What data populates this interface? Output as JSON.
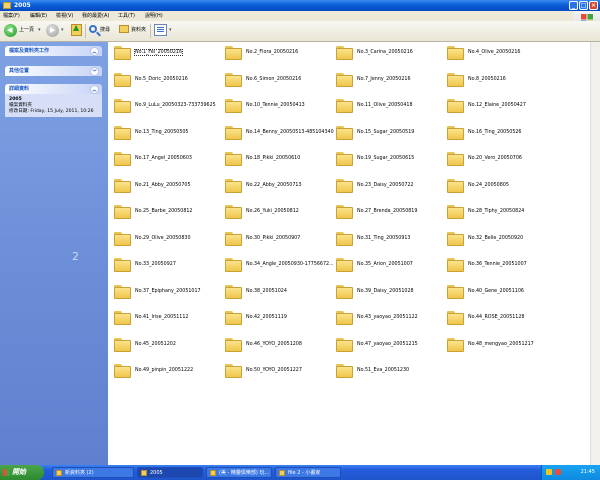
{
  "window": {
    "title": "2005"
  },
  "menu": [
    "檔案(F)",
    "編輯(E)",
    "檢視(V)",
    "我的最愛(A)",
    "工具(T)",
    "說明(H)"
  ],
  "toolbar": {
    "back": "上一頁",
    "search": "搜尋",
    "folders": "資料夾"
  },
  "sidebar": {
    "panels": [
      {
        "title": "檔案及資料夾工作"
      },
      {
        "title": "其他位置"
      },
      {
        "title": "詳細資料",
        "name": "2005",
        "type": "檔案資料夾",
        "modified": "修改日期: Friday, 15 July, 2011, 10:26"
      }
    ],
    "page_number": "2"
  },
  "folders": [
    "No.1_Fei_20050216",
    "No.2_Flora_20050216",
    "No.3_Carina_20050216",
    "No.4_Olive_20050216",
    "No.5_Doric_20050216",
    "No.6_Simon_20050216",
    "No.7_Jenny_20050216",
    "No.8_20050216",
    "No.9_LuLu_20050323-733739625",
    "No.10_Tennie_20050413",
    "No.11_Olive_20050418",
    "No.12_Elaine_20050427",
    "No.13_Ting_20050505",
    "No.14_Benny_20050513-485104340",
    "No.15_Sugar_20050519",
    "No.16_Ting_20050526",
    "No.17_Angel_20050603",
    "No.18_Pikki_20050610",
    "No.19_Sugar_20050615",
    "No.20_Vero_20050706",
    "No.21_Abby_20050705",
    "No.22_Abby_20050713",
    "No.23_Daisy_20050722",
    "No.24_20050805",
    "No.25_Barbe_20050812",
    "No.26_Yuki_20050812",
    "No.27_Brenda_20050819",
    "No.28_Tiphy_20050824",
    "No.29_Olive_20050830",
    "No.30_Pikki_20050907",
    "No.31_Ting_20050913",
    "No.32_Belle_20050920",
    "No.33_20050927",
    "No.34_Angle_20050930-17756672...",
    "No.35_Arion_20051007",
    "No.36_Tennie_20051007",
    "No.37_Epiphany_20051017",
    "No.38_20051024",
    "No.39_Daisy_20051028",
    "No.40_Gene_20051106",
    "No.41_Irise_20051112",
    "No.42_20051119",
    "No.43_yaoyao_20051122",
    "No.44_ROSE_20051128",
    "No.45_20051202",
    "No.46_YOYO_20051208",
    "No.47_yaoyao_20051215",
    "No.48_mengyao_20051217",
    "No.49_pinpin_20051222",
    "No.50_YOYO_20051227",
    "No.51_Eva_20051230"
  ],
  "taskbar": {
    "start": "開始",
    "tasks": [
      "新資料夾 (2)",
      "2005",
      "(美 - 精靈俱樂部) 玩...",
      "file 2 - 小畫家"
    ],
    "clock": "21:45"
  }
}
